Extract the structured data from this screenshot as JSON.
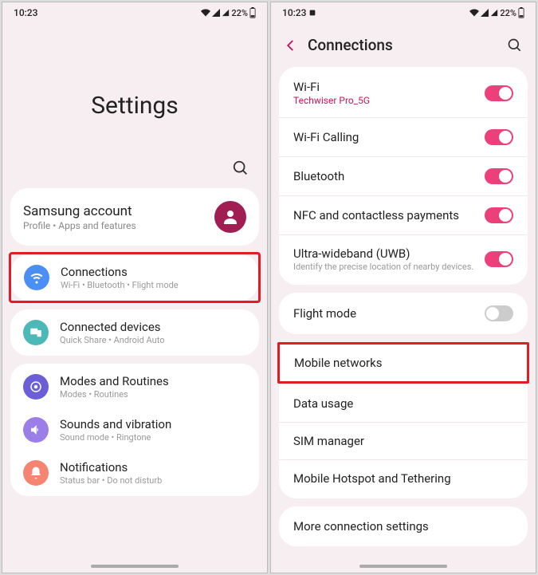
{
  "status": {
    "time": "10:23",
    "battery": "22%"
  },
  "left": {
    "title": "Settings",
    "account": {
      "title": "Samsung account",
      "sub": "Profile  •  Apps and features"
    },
    "connections": {
      "title": "Connections",
      "sub": "Wi-Fi  •  Bluetooth  •  Flight mode"
    },
    "connected": {
      "title": "Connected devices",
      "sub": "Quick Share  •  Android Auto"
    },
    "modes": {
      "title": "Modes and Routines",
      "sub": "Modes  •  Routines"
    },
    "sounds": {
      "title": "Sounds and vibration",
      "sub": "Sound mode  •  Ringtone"
    },
    "notif": {
      "title": "Notifications",
      "sub": "Status bar  •  Do not disturb"
    }
  },
  "right": {
    "header": "Connections",
    "wifi": {
      "title": "Wi-Fi",
      "sub": "Techwiser Pro_5G"
    },
    "wifiCall": {
      "title": "Wi-Fi Calling"
    },
    "bt": {
      "title": "Bluetooth"
    },
    "nfc": {
      "title": "NFC and contactless payments"
    },
    "uwb": {
      "title": "Ultra-wideband (UWB)",
      "sub": "Identify the precise location of nearby devices."
    },
    "flight": {
      "title": "Flight mode"
    },
    "mobile": {
      "title": "Mobile networks"
    },
    "data": {
      "title": "Data usage"
    },
    "sim": {
      "title": "SIM manager"
    },
    "hotspot": {
      "title": "Mobile Hotspot and Tethering"
    },
    "more": {
      "title": "More connection settings"
    }
  }
}
